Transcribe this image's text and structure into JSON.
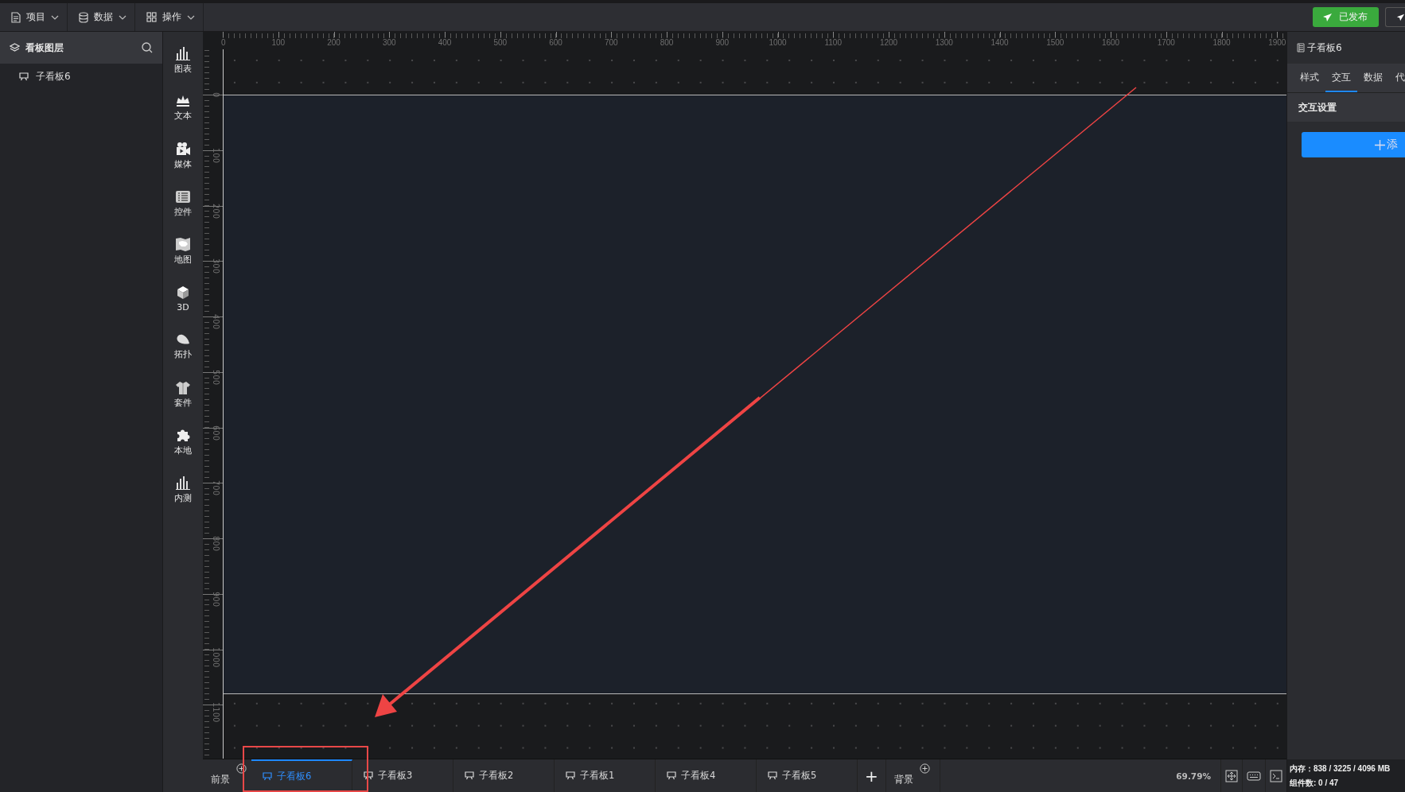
{
  "menu": [
    {
      "label": "项目"
    },
    {
      "label": "数据"
    },
    {
      "label": "操作"
    }
  ],
  "publish_button": "已发布",
  "layer_panel": {
    "title": "看板图层",
    "items": [
      {
        "label": "子看板6"
      }
    ]
  },
  "tools": [
    "图表",
    "文本",
    "媒体",
    "控件",
    "地图",
    "3D",
    "拓扑",
    "套件",
    "本地",
    "内测"
  ],
  "ruler": {
    "x_labels": [
      "0",
      "100",
      "200",
      "300",
      "400",
      "500",
      "600",
      "700",
      "800",
      "900",
      "1000",
      "1100",
      "1200",
      "1300",
      "1400",
      "1500",
      "1600",
      "1700",
      "1800",
      "1900"
    ],
    "y_labels": [
      "0",
      "100",
      "200",
      "300",
      "400",
      "500",
      "600",
      "700",
      "800",
      "900",
      "1000",
      "1100"
    ]
  },
  "right_panel": {
    "title": "子看板6",
    "tabs": [
      {
        "label": "样式",
        "selected": false
      },
      {
        "label": "交互",
        "selected": true
      },
      {
        "label": "数据",
        "selected": false
      },
      {
        "label": "代",
        "selected": false
      }
    ],
    "section": "交互设置",
    "add_button": "添"
  },
  "bottom_bar": {
    "foreground": "前景",
    "tabs": [
      {
        "label": "子看板6",
        "selected": true
      },
      {
        "label": "子看板3",
        "selected": false
      },
      {
        "label": "子看板2",
        "selected": false
      },
      {
        "label": "子看板1",
        "selected": false
      },
      {
        "label": "子看板4",
        "selected": false
      },
      {
        "label": "子看板5",
        "selected": false
      }
    ],
    "add_tab": "+",
    "background": "背景",
    "zoom": "69.79%"
  },
  "status": {
    "memory": "内存：838 / 3225 / 4096 MB",
    "components": "组件数: 0 / 47"
  }
}
